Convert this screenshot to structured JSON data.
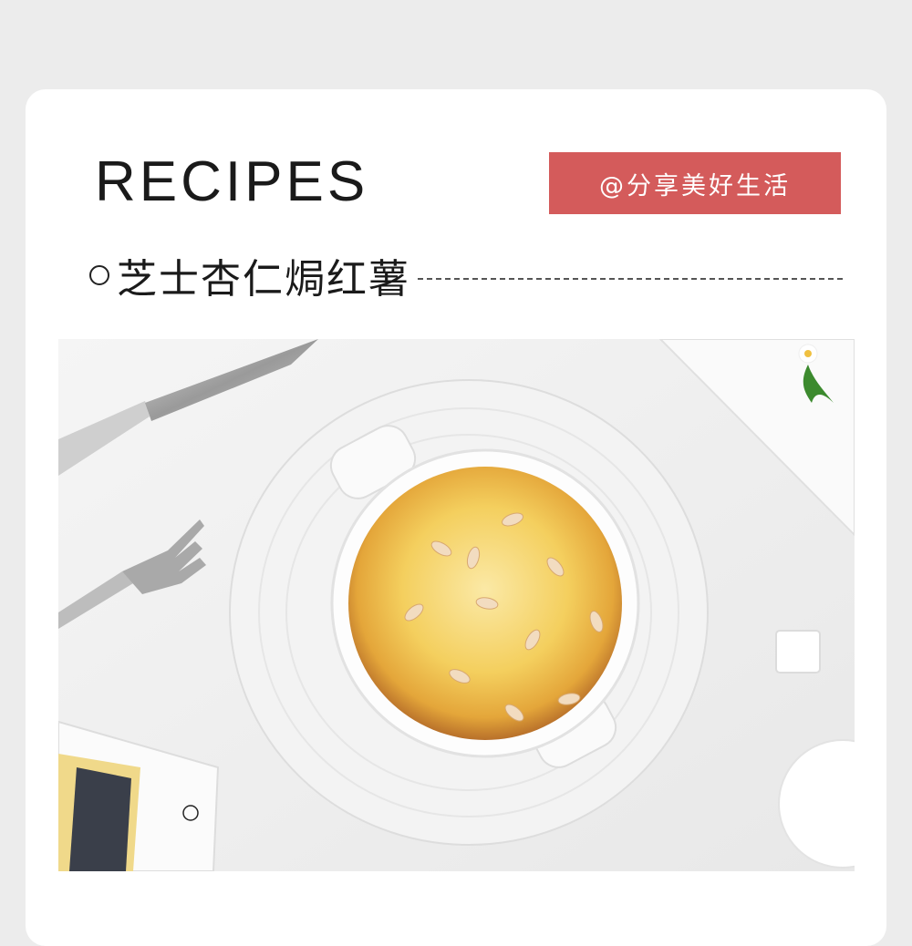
{
  "header": {
    "title": "RECIPES",
    "tag": "@分享美好生活"
  },
  "recipe": {
    "name": "芝士杏仁焗红薯"
  },
  "photo": {
    "description_icon": "baked-dish-icon"
  },
  "colors": {
    "background": "#ececec",
    "card": "#ffffff",
    "accent": "#d45b5b"
  }
}
